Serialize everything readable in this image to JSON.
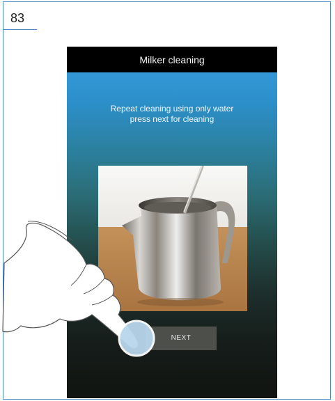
{
  "page": {
    "number": "83"
  },
  "screen": {
    "title": "Milker cleaning",
    "instruction_line1": "Repeat cleaning using only water",
    "instruction_line2": "press next for cleaning",
    "next_label": "NEXT"
  },
  "colors": {
    "border_blue": "#4f88c6",
    "gradient_top": "#3a9fe3",
    "gradient_bottom": "#101411",
    "button_gray": "#4d4f4a",
    "touch_point": "#b8d6ec"
  },
  "icons": [
    "hand-pointer-icon",
    "touch-indicator-icon"
  ]
}
